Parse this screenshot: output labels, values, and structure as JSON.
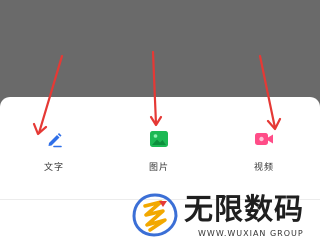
{
  "share_sheet": {
    "options": [
      {
        "label": "文字",
        "icon": "pencil-icon",
        "color": "#2f6fe8"
      },
      {
        "label": "图片",
        "icon": "image-icon",
        "color": "#1db954"
      },
      {
        "label": "视频",
        "icon": "video-camera-icon",
        "color": "#ff4d88"
      }
    ]
  },
  "annotation": {
    "arrow_color": "#e53935"
  },
  "watermark": {
    "title": "无限数码",
    "subtitle": "WWW.WUXIAN GROUP",
    "colors": [
      "#3b6fd6",
      "#f2a800",
      "#e53935"
    ]
  }
}
